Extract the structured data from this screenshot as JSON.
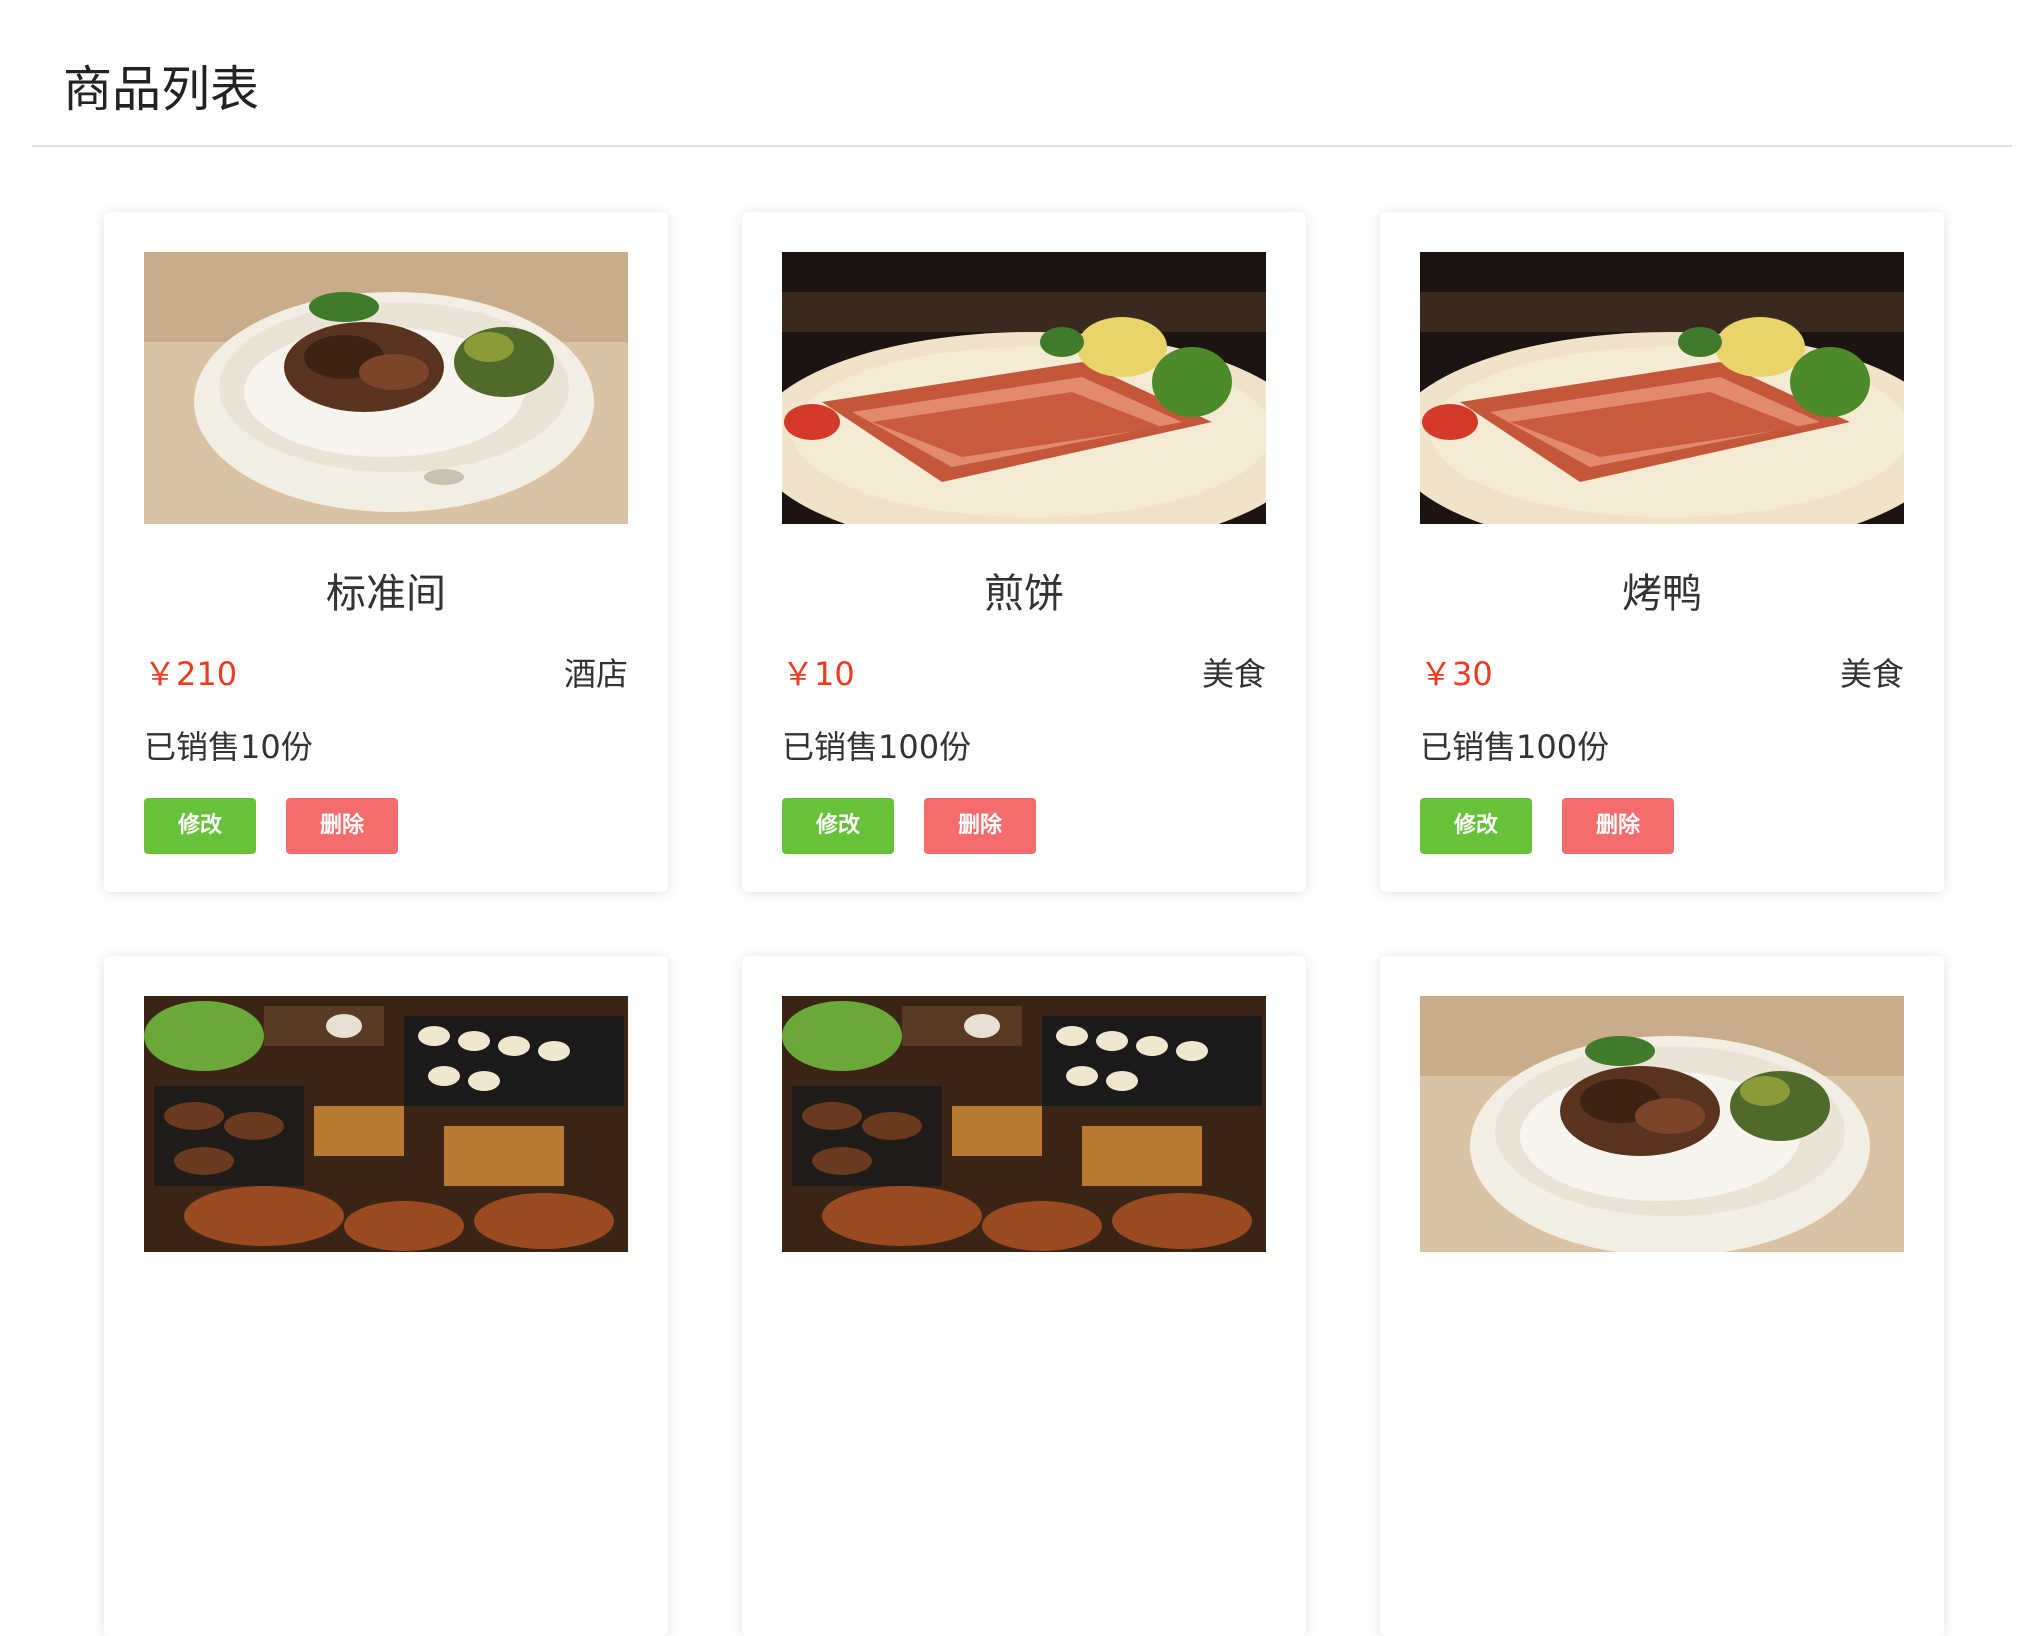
{
  "page": {
    "title": "商品列表"
  },
  "colors": {
    "price": "#ee3a1f",
    "edit_button": "#67c23a",
    "delete_button": "#f56c6c",
    "divider": "#e0e0e0"
  },
  "products": [
    {
      "image_icon": "rice-bowl-image",
      "name": "标准间",
      "price": "￥210",
      "category": "酒店",
      "sold": "已销售10份",
      "edit_label": "修改",
      "delete_label": "删除"
    },
    {
      "image_icon": "bacon-plate-image",
      "name": "煎饼",
      "price": "￥10",
      "category": "美食",
      "sold": "已销售100份",
      "edit_label": "修改",
      "delete_label": "删除"
    },
    {
      "image_icon": "bacon-plate-image",
      "name": "烤鸭",
      "price": "￥30",
      "category": "美食",
      "sold": "已销售100份",
      "edit_label": "修改",
      "delete_label": "删除"
    },
    {
      "image_icon": "skewers-image"
    },
    {
      "image_icon": "skewers-image"
    },
    {
      "image_icon": "rice-bowl-image"
    }
  ]
}
